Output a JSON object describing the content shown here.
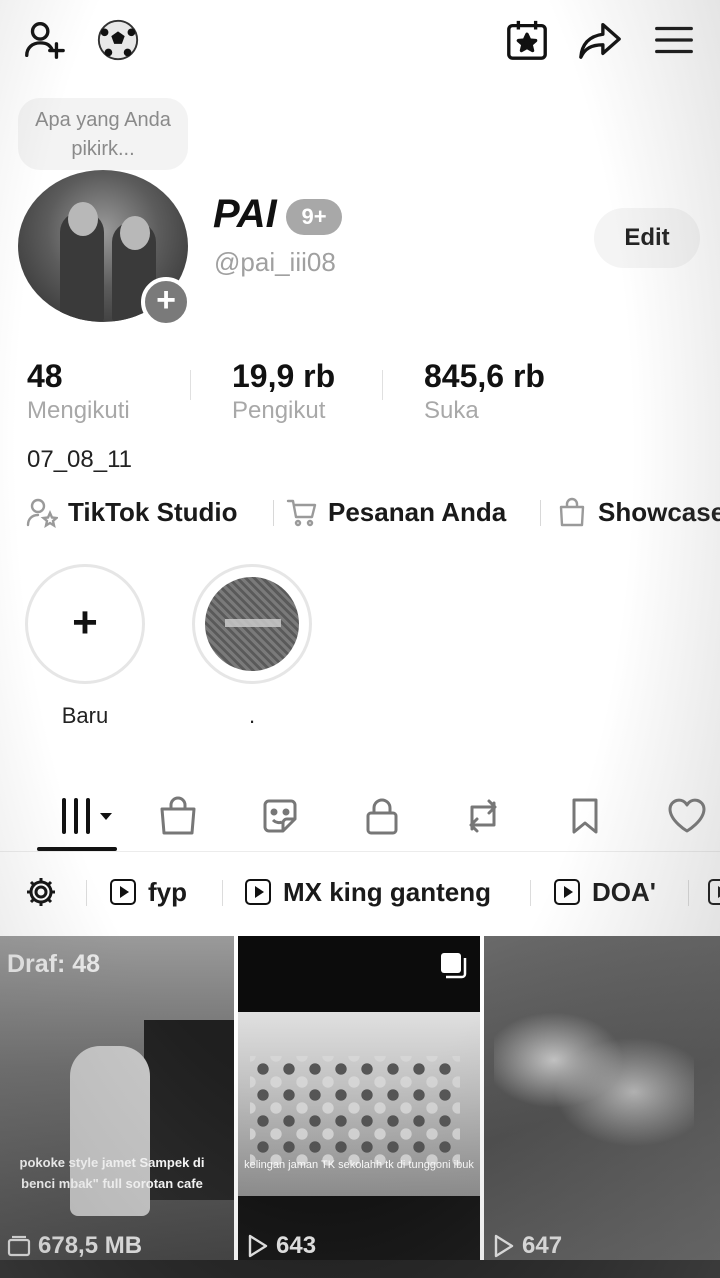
{
  "header": {
    "icons": [
      "add-friend-icon",
      "soccer-ball-icon",
      "calendar-star-icon",
      "share-icon",
      "menu-icon"
    ]
  },
  "thought_bubble": {
    "placeholder": "Apa yang Anda pikirk..."
  },
  "profile": {
    "display_name": "PAI",
    "notification_badge": "9+",
    "username": "@pai_iii08",
    "edit_label": "Edit",
    "bio": "07_08_11"
  },
  "stats": [
    {
      "value": "48",
      "label": "Mengikuti"
    },
    {
      "value": "19,9 rb",
      "label": "Pengikut"
    },
    {
      "value": "845,6 rb",
      "label": "Suka"
    }
  ],
  "quick_links": [
    {
      "icon": "person-star-icon",
      "label": "TikTok Studio"
    },
    {
      "icon": "cart-icon",
      "label": "Pesanan Anda"
    },
    {
      "icon": "bag-icon",
      "label": "Showcase"
    }
  ],
  "stories": [
    {
      "label": "Baru",
      "icon": "plus-icon"
    },
    {
      "label": "."
    }
  ],
  "content_tabs": [
    "grid-icon",
    "shopping-bag-icon",
    "sticker-icon",
    "lock-icon",
    "repost-icon",
    "bookmark-icon",
    "heart-icon"
  ],
  "playlists": {
    "settings_icon": "gear-icon",
    "items": [
      "fyp",
      "MX king ganteng",
      "DOA'"
    ]
  },
  "videos": [
    {
      "draft_label": "Draf: 48",
      "caption": "pokoke style jamet Sampek di benci mbak\" full sorotan cafe",
      "meta": "678,5 MB"
    },
    {
      "caption": "kelingan jaman TK sekolahh tk di tunggoni ibuk",
      "meta": "643"
    },
    {
      "meta": "647"
    }
  ],
  "colors": {
    "accent": "#111111",
    "muted": "#a8a8a8",
    "badge": "#a8a8a8"
  }
}
